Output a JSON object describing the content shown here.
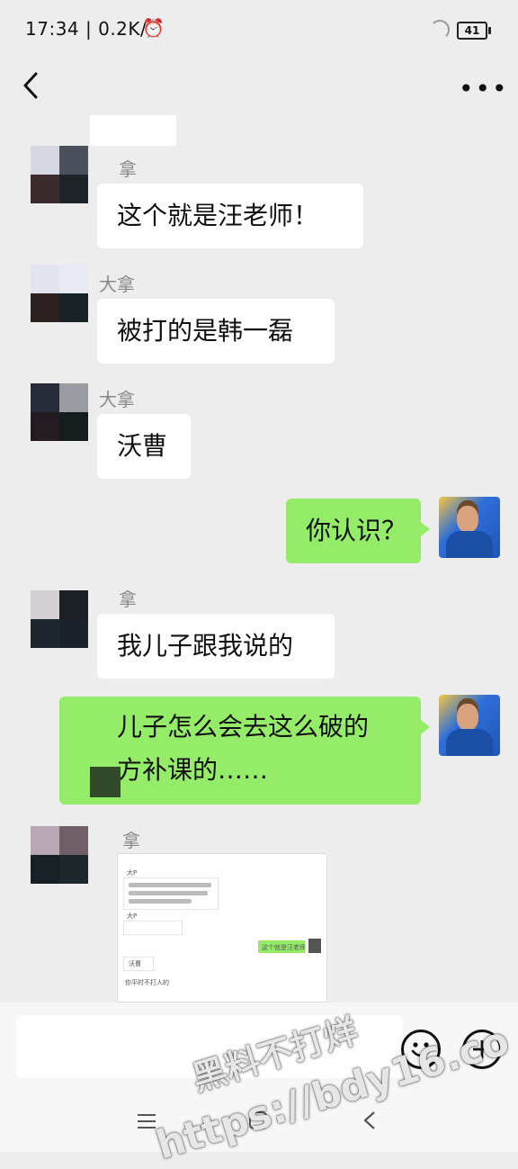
{
  "status_bar": {
    "time": "17:34 | 0.2K/s",
    "battery": "41"
  },
  "messages": [
    {
      "side": "in",
      "sender": "拿",
      "text": "这个就是汪老师！"
    },
    {
      "side": "in",
      "sender": "大拿",
      "text": "被打的是韩一磊"
    },
    {
      "side": "in",
      "sender": "大拿",
      "text": "沃曹"
    },
    {
      "side": "out",
      "text": "你认识？"
    },
    {
      "side": "in",
      "sender": "拿",
      "text": "我儿子跟我说的"
    },
    {
      "side": "out",
      "text_line1": "儿子怎么会去这么破的",
      "text_line2": "方补课的……"
    },
    {
      "side": "in",
      "sender": "拿",
      "type": "image"
    }
  ],
  "screenshot_preview": {
    "name1": "大P",
    "name2": "大P",
    "out_text": "这个就是汪老师",
    "line_a": "沃曹",
    "line_b": "你平时不打人的"
  },
  "watermark": {
    "line1": "黑料不打烊",
    "line2": "https://bdy16.co"
  },
  "icons": {
    "emoji": "emoji-icon",
    "add": "plus-circle-icon"
  }
}
